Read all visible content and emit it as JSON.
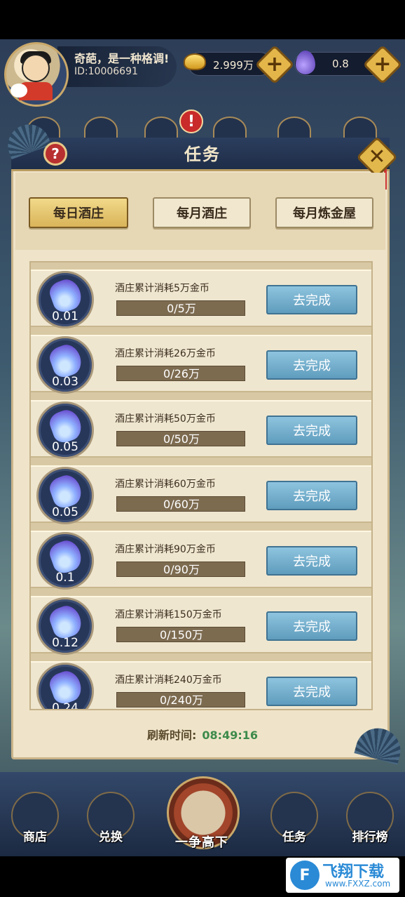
{
  "player": {
    "name": "奇葩，是一种格调!",
    "id": "ID:10006691"
  },
  "resources": {
    "gold": "2.999万",
    "gem": "0.8",
    "plus": "+"
  },
  "panel": {
    "title": "任务",
    "help": "?",
    "close": "✕"
  },
  "tabs": [
    {
      "label": "每日酒庄",
      "active": true
    },
    {
      "label": "每月酒庄",
      "active": false
    },
    {
      "label": "每月炼金屋",
      "active": false
    }
  ],
  "tasks": [
    {
      "reward": "0.01",
      "desc": "酒庄累计消耗5万金币",
      "progress_text": "0/5万",
      "progress": 0,
      "button": "去完成"
    },
    {
      "reward": "0.03",
      "desc": "酒庄累计消耗26万金币",
      "progress_text": "0/26万",
      "progress": 0,
      "button": "去完成"
    },
    {
      "reward": "0.05",
      "desc": "酒庄累计消耗50万金币",
      "progress_text": "0/50万",
      "progress": 0,
      "button": "去完成"
    },
    {
      "reward": "0.05",
      "desc": "酒庄累计消耗60万金币",
      "progress_text": "0/60万",
      "progress": 0,
      "button": "去完成"
    },
    {
      "reward": "0.1",
      "desc": "酒庄累计消耗90万金币",
      "progress_text": "0/90万",
      "progress": 0,
      "button": "去完成"
    },
    {
      "reward": "0.12",
      "desc": "酒庄累计消耗150万金币",
      "progress_text": "0/150万",
      "progress": 0,
      "button": "去完成"
    },
    {
      "reward": "0.24",
      "desc": "酒庄累计消耗240万金币",
      "progress_text": "0/240万",
      "progress": 0,
      "button": "去完成"
    }
  ],
  "refresh": {
    "label": "刷新时间:",
    "time": "08:49:16"
  },
  "nav": {
    "shop": "商店",
    "exchange": "兑换",
    "compete": "一争高下",
    "tasks": "任务",
    "ranking": "排行榜"
  },
  "watermark": {
    "logo": "F",
    "title": "飞翔下载",
    "url": "www.FXXZ.com"
  },
  "alert": "!"
}
